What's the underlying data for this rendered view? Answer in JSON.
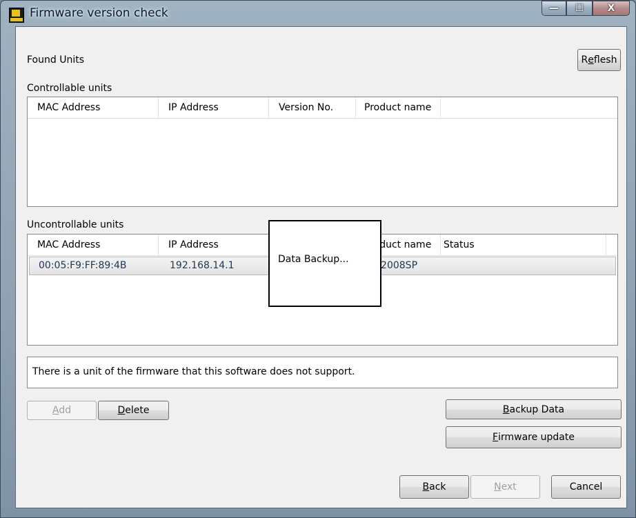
{
  "window": {
    "title": "Firmware version check",
    "controls": {
      "minimize": "—",
      "maximize": "☐",
      "close": "X"
    }
  },
  "found_units_label": "Found Units",
  "refresh_button": {
    "prefix": "R",
    "accel": "e",
    "rest": "flesh"
  },
  "controllable": {
    "label": "Controllable units",
    "columns": [
      "MAC Address",
      "IP Address",
      "Version No.",
      "Product name"
    ],
    "rows": []
  },
  "uncontrollable": {
    "label": "Uncontrollable units",
    "columns": [
      "MAC Address",
      "IP Address",
      "",
      "Product name",
      "Status"
    ],
    "rows": [
      {
        "mac": "00:05:F9:FF:89:4B",
        "ip": "192.168.14.1",
        "product": "-2008SP",
        "status": ""
      }
    ]
  },
  "message": "There is a unit of the firmware that this software does not support.",
  "popup": {
    "text": "Data Backup..."
  },
  "buttons": {
    "add": {
      "accel": "A",
      "rest": "dd",
      "enabled": false
    },
    "delete": {
      "accel": "D",
      "rest": "elete",
      "enabled": true
    },
    "backup_data": {
      "accel": "B",
      "rest": "ackup Data",
      "enabled": true
    },
    "firmware_update": {
      "accel": "F",
      "rest": "irmware update",
      "enabled": true
    },
    "back": {
      "accel": "B",
      "rest": "ack",
      "enabled": true
    },
    "next": {
      "accel": "N",
      "rest": "ext",
      "enabled": false
    },
    "cancel": {
      "label": "Cancel",
      "enabled": true
    }
  },
  "colors": {
    "row_text": "#1d3552",
    "disabled_text": "#a0a0a0"
  }
}
